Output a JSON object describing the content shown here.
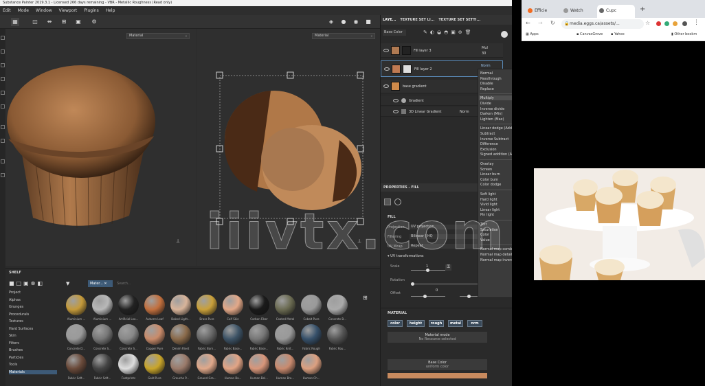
{
  "window": {
    "title": "Substance Painter 2019.3.1 - Licensed 266 days remaining - VBR - Metallic Roughness (Read only)",
    "menu": [
      "Edit",
      "Mode",
      "Window",
      "Viewport",
      "Plugins",
      "Help"
    ]
  },
  "viewports": {
    "left_dropdown": "Material",
    "right_dropdown": "Material"
  },
  "layers_panel": {
    "tabs": [
      "LAYE...",
      "TEXTURE SET LI...",
      "TEXTURE SET SETTI..."
    ],
    "blend_select": "Base Color",
    "layers": [
      {
        "name": "Fill layer 3",
        "blend": "Mul",
        "opacity": "30"
      },
      {
        "name": "Fill layer 2",
        "blend": "Norm"
      },
      {
        "name": "base gradient"
      },
      {
        "name": "Gradient"
      },
      {
        "name": "3D Linear Gradient",
        "blend": "Norm"
      }
    ]
  },
  "blend_menu": {
    "highlighted": "Multiply",
    "groups": [
      [
        "Normal",
        "Passthrough",
        "Disable",
        "Replace"
      ],
      [
        "Multiply",
        "Divide",
        "Inverse divide",
        "Darken (Min)",
        "Lighten (Max)"
      ],
      [
        "Linear dodge (Add)",
        "Subtract",
        "Inverse Subtract",
        "Difference",
        "Exclusion",
        "Signed addition (AddSub)"
      ],
      [
        "Overlay",
        "Screen",
        "Linear burn",
        "Color burn",
        "Color dodge"
      ],
      [
        "Soft light",
        "Hard light",
        "Vivid light",
        "Linear light",
        "Pin light"
      ],
      [
        "Tint",
        "Saturation",
        "Color",
        "Value"
      ],
      [
        "Normal map combine",
        "Normal map detail",
        "Normal map inverse detail"
      ]
    ]
  },
  "properties": {
    "title": "PROPERTIES - FILL",
    "fill_header": "FILL",
    "projection_label": "Projection",
    "projection_value": "UV projection",
    "filtering_label": "Filtering",
    "filtering_value": "Bilinear | HQ",
    "uv_wrap_label": "UV Wrap",
    "uv_wrap_value": "Repeat",
    "uv_transform_label": "UV transformations",
    "scale_label": "Scale",
    "scale_value": "1",
    "rotation_label": "Rotation",
    "offset_label": "Offset",
    "offset_value": "0",
    "material_header": "MATERIAL",
    "channels": [
      "color",
      "height",
      "rough",
      "metal",
      "nrm"
    ],
    "material_mode": "Material mode",
    "material_mode_sub": "No Resource selected",
    "base_color": "Base Color",
    "base_color_sub": "uniform color"
  },
  "shelf": {
    "title": "SHELF",
    "filter_chip": "Mater...",
    "search_placeholder": "Search...",
    "categories": [
      "Project",
      "Alphas",
      "Grunges",
      "Procedurals",
      "Textures",
      "Hard Surfaces",
      "Skin",
      "Filters",
      "Brushes",
      "Particles",
      "Tools",
      "Materials"
    ],
    "selected_category": "Materials",
    "materials": [
      {
        "label": "Aluminium ...",
        "color": "#c49a3a"
      },
      {
        "label": "Aluminium ...",
        "color": "#b8b8b8"
      },
      {
        "label": "Artificial Lea...",
        "color": "#222"
      },
      {
        "label": "Autumn Leaf",
        "color": "#c2703e"
      },
      {
        "label": "Baked Light...",
        "color": "#d8b49a"
      },
      {
        "label": "Brass Pure",
        "color": "#c9a03a"
      },
      {
        "label": "Calf Skin",
        "color": "#e3a888"
      },
      {
        "label": "Carbon Fiber",
        "color": "#1a1a1a"
      },
      {
        "label": "Coated Metal",
        "color": "#6b6b52"
      },
      {
        "label": "Cobalt Pure",
        "color": "#9a9a9a"
      },
      {
        "label": "Concrete B...",
        "color": "#aaaaaa"
      },
      {
        "label": "Concrete D...",
        "color": "#9a9a9a"
      },
      {
        "label": "Concrete S...",
        "color": "#777"
      },
      {
        "label": "Concrete S...",
        "color": "#888"
      },
      {
        "label": "Copper Pure",
        "color": "#c98b6a"
      },
      {
        "label": "Denim Rivet",
        "color": "#8a6a4a"
      },
      {
        "label": "Fabric Barn...",
        "color": "#666"
      },
      {
        "label": "Fabric Base...",
        "color": "#3d5366"
      },
      {
        "label": "Fabric Base...",
        "color": "#777"
      },
      {
        "label": "Fabric Knit...",
        "color": "#999"
      },
      {
        "label": "Fabric Rough",
        "color": "#36506a"
      },
      {
        "label": "Fabric Rou...",
        "color": "#555"
      },
      {
        "label": "Fabric Soft...",
        "color": "#6a4a3a"
      },
      {
        "label": "Fabric Soft...",
        "color": "#444"
      },
      {
        "label": "Footprints",
        "color": "#ddd"
      },
      {
        "label": "Gold Pure",
        "color": "#c9a52a"
      },
      {
        "label": "Grouche P...",
        "color": "#9a7a6a"
      },
      {
        "label": "Ground Gra...",
        "color": "#e0a88a"
      },
      {
        "label": "Human Ba...",
        "color": "#e2a485"
      },
      {
        "label": "Human Bel...",
        "color": "#d8967a"
      },
      {
        "label": "Human Bro...",
        "color": "#c98a6e"
      },
      {
        "label": "Human Ch...",
        "color": "#dca080"
      }
    ]
  },
  "browser": {
    "tabs": [
      "Efficie",
      "Watch",
      "Cupc"
    ],
    "address": "media.eggs.ca/assets/...",
    "bookmarks": [
      "Apps",
      "CanvasGrove",
      "Yahoo",
      "Other bookm"
    ]
  },
  "watermark": "iiivtx.com"
}
